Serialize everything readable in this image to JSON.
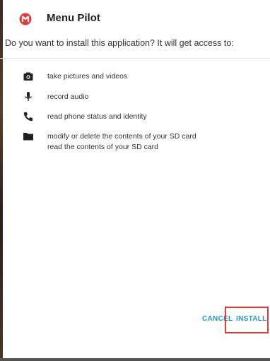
{
  "app": {
    "title": "Menu Pilot",
    "icon": "app-logo-icon",
    "brand_color": "#e53935"
  },
  "dialog": {
    "prompt": "Do you want to install this application? It will get access to:"
  },
  "permissions": [
    {
      "icon": "camera-icon",
      "lines": [
        "take pictures and videos"
      ]
    },
    {
      "icon": "microphone-icon",
      "lines": [
        "record audio"
      ]
    },
    {
      "icon": "phone-icon",
      "lines": [
        "read phone status and identity"
      ]
    },
    {
      "icon": "folder-icon",
      "lines": [
        "modify or delete the contents of your SD card",
        "read the contents of your SD card"
      ]
    }
  ],
  "actions": {
    "cancel_label": "CANCEL",
    "install_label": "INSTALL",
    "accent_color": "#2196c9",
    "highlight_color": "#e03a3a"
  }
}
